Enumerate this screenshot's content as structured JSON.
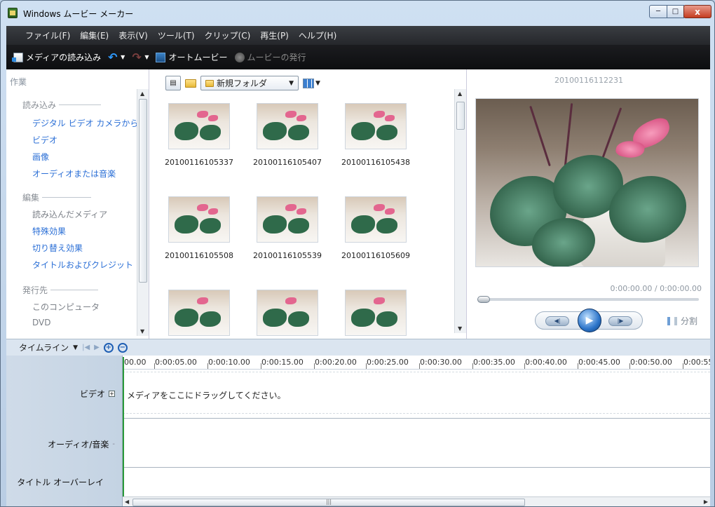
{
  "window": {
    "title": "Windows ムービー メーカー",
    "controls": {
      "minimize": "─",
      "maximize": "□",
      "close": "x"
    }
  },
  "menu": [
    "ファイル(F)",
    "編集(E)",
    "表示(V)",
    "ツール(T)",
    "クリップ(C)",
    "再生(P)",
    "ヘルプ(H)"
  ],
  "toolbar": {
    "import": "メディアの読み込み",
    "automovie": "オートムービー",
    "publish": "ムービーの発行"
  },
  "tasks": {
    "title": "作業",
    "sections": [
      {
        "label": "読み込み",
        "items": [
          "デジタル ビデオ カメラから",
          "ビデオ",
          "画像",
          "オーディオまたは音楽"
        ]
      },
      {
        "label": "編集",
        "items": [
          "読み込んだメディア",
          "特殊効果",
          "切り替え効果",
          "タイトルおよびクレジット"
        ]
      },
      {
        "label": "発行先",
        "items": [
          "このコンピュータ",
          "DVD"
        ]
      }
    ]
  },
  "collection": {
    "folder": "新規フォルダ",
    "clips": [
      "20100116105337",
      "20100116105407",
      "20100116105438",
      "20100116105508",
      "20100116105539",
      "20100116105609",
      "",
      "",
      ""
    ]
  },
  "preview": {
    "clip_name": "20100116112231",
    "time": "0:00:00.00 / 0:00:00.00",
    "split_label": "分割"
  },
  "timeline": {
    "label": "タイムライン",
    "ruler": [
      "00.00",
      "0:00:05.00",
      "0:00:10.00",
      "0:00:15.00",
      "0:00:20.00",
      "0:00:25.00",
      "0:00:30.00",
      "0:00:35.00",
      "0:00:40.00",
      "0:00:45.00",
      "0:00:50.00",
      "0:00:55"
    ],
    "tracks": {
      "video": "ビデオ",
      "audio": "オーディオ/音楽",
      "title": "タイトル オーバーレイ"
    },
    "video_hint": "メディアをここにドラッグしてください。"
  }
}
